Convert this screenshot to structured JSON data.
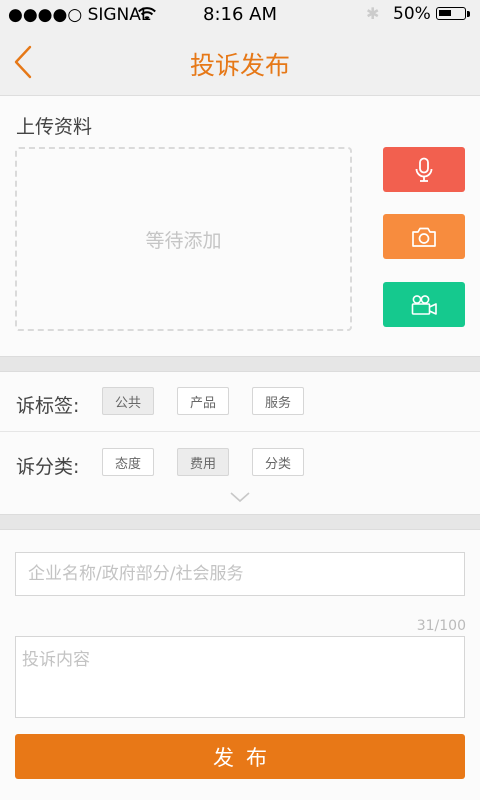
{
  "status_bar": {
    "carrier": "●●●●○ SIGNAL",
    "time": "8:16 AM",
    "bluetooth": "✱",
    "battery_percent": "50%",
    "battery_level": 0.5
  },
  "nav": {
    "title": "投诉发布",
    "back_icon": "chevron-left-icon",
    "accent_color": "#e67817"
  },
  "upload": {
    "label": "上传资料",
    "dropzone_text": "等待添加",
    "buttons": [
      {
        "name": "record-audio-button",
        "icon": "microphone-icon",
        "color": "#f2604f"
      },
      {
        "name": "take-photo-button",
        "icon": "camera-icon",
        "color": "#f78c3e"
      },
      {
        "name": "record-video-button",
        "icon": "video-camera-icon",
        "color": "#15c98e"
      }
    ]
  },
  "tags": {
    "label_tags": "诉标签:",
    "tag_options": [
      {
        "label": "公共",
        "selected": true
      },
      {
        "label": "产品",
        "selected": false
      },
      {
        "label": "服务",
        "selected": false
      }
    ],
    "label_category": "诉分类:",
    "category_options": [
      {
        "label": "态度",
        "selected": false
      },
      {
        "label": "费用",
        "selected": true
      },
      {
        "label": "分类",
        "selected": false
      }
    ],
    "expand_icon": "chevron-down-icon"
  },
  "form": {
    "target_placeholder": "企业名称/政府部分/社会服务",
    "counter": "31/100",
    "content_placeholder": "投诉内容",
    "publish_label": "发布",
    "publish_color": "#e87817"
  }
}
